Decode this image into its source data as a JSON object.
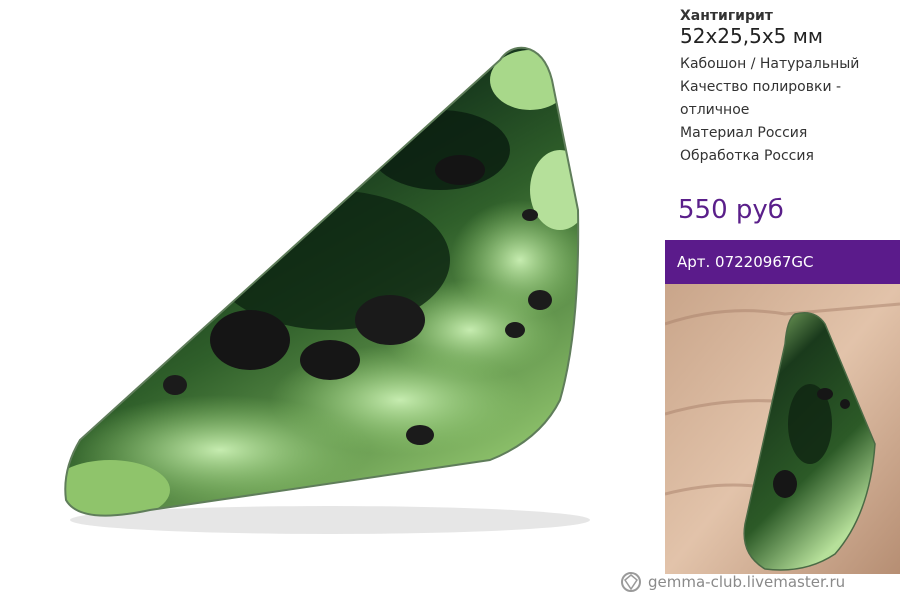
{
  "product": {
    "name": "Хантигирит",
    "size": "52х25,5х5 мм",
    "lines": [
      "Кабошон / Натуральный",
      "Качество полировки -",
      "отличное",
      "Материал Россия",
      "Обработка Россия"
    ],
    "price": "550 руб",
    "sku": "Арт. 07220967GC"
  },
  "watermark": {
    "text": "gemma-club.livemaster.ru",
    "icon": "gem-logo-icon"
  },
  "colors": {
    "accent": "#5b1b8b",
    "price": "#5a1f8a",
    "stone_dark": "#0f2a14",
    "stone_light": "#9fd07a"
  }
}
